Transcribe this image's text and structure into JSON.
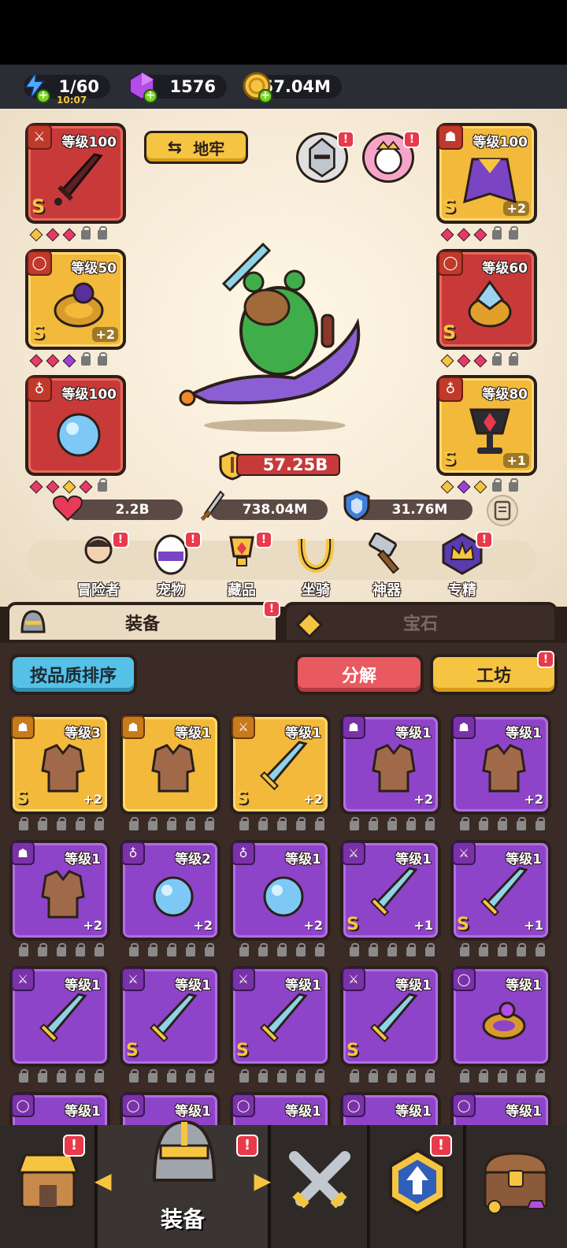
{
  "resources": {
    "energy": "1/60",
    "energy_timer": "10:07",
    "gems": "1576",
    "gold": "57.04M"
  },
  "arena": {
    "dungeon_label": "地牢",
    "combat_power": "57.25B",
    "stats": {
      "hp": "2.2B",
      "attack": "738.04M",
      "defense": "31.76M"
    },
    "left_slots": [
      {
        "level": "等级100",
        "quality": "S",
        "plus": "",
        "type": "sword"
      },
      {
        "level": "等级50",
        "quality": "S",
        "plus": "+2",
        "type": "ring"
      },
      {
        "level": "等级100",
        "quality": "",
        "plus": "",
        "type": "necklace"
      }
    ],
    "right_slots": [
      {
        "level": "等级100",
        "quality": "S",
        "plus": "+2",
        "type": "armor"
      },
      {
        "level": "等级60",
        "quality": "S",
        "plus": "",
        "type": "ring"
      },
      {
        "level": "等级80",
        "quality": "S",
        "plus": "+1",
        "type": "necklace"
      }
    ]
  },
  "nav": [
    {
      "label": "冒险者"
    },
    {
      "label": "宠物"
    },
    {
      "label": "藏品"
    },
    {
      "label": "坐骑"
    },
    {
      "label": "神器"
    },
    {
      "label": "专精"
    }
  ],
  "tabs": {
    "equip": "装备",
    "gem": "宝石"
  },
  "actions": {
    "sort": "按品质排序",
    "decompose": "分解",
    "workshop": "工坊"
  },
  "inventory": [
    {
      "level": "等级3",
      "quality": "S",
      "plus": "+2",
      "rarity": "gold",
      "type": "armor"
    },
    {
      "level": "等级1",
      "quality": "",
      "plus": "",
      "rarity": "gold",
      "type": "armor"
    },
    {
      "level": "等级1",
      "quality": "S",
      "plus": "+2",
      "rarity": "gold",
      "type": "sword"
    },
    {
      "level": "等级1",
      "quality": "",
      "plus": "+2",
      "rarity": "purple",
      "type": "armor"
    },
    {
      "level": "等级1",
      "quality": "",
      "plus": "+2",
      "rarity": "purple",
      "type": "armor"
    },
    {
      "level": "等级1",
      "quality": "",
      "plus": "+2",
      "rarity": "purple",
      "type": "armor"
    },
    {
      "level": "等级2",
      "quality": "",
      "plus": "+2",
      "rarity": "purple",
      "type": "necklace"
    },
    {
      "level": "等级1",
      "quality": "",
      "plus": "+2",
      "rarity": "purple",
      "type": "necklace"
    },
    {
      "level": "等级1",
      "quality": "S",
      "plus": "+1",
      "rarity": "purple",
      "type": "sword"
    },
    {
      "level": "等级1",
      "quality": "S",
      "plus": "+1",
      "rarity": "purple",
      "type": "sword"
    },
    {
      "level": "等级1",
      "quality": "",
      "plus": "",
      "rarity": "purple",
      "type": "sword"
    },
    {
      "level": "等级1",
      "quality": "S",
      "plus": "",
      "rarity": "purple",
      "type": "sword"
    },
    {
      "level": "等级1",
      "quality": "S",
      "plus": "",
      "rarity": "purple",
      "type": "sword"
    },
    {
      "level": "等级1",
      "quality": "S",
      "plus": "",
      "rarity": "purple",
      "type": "sword"
    },
    {
      "level": "等级1",
      "quality": "",
      "plus": "",
      "rarity": "purple",
      "type": "ring"
    },
    {
      "level": "等级1",
      "quality": "",
      "plus": "",
      "rarity": "purple",
      "type": "ring"
    },
    {
      "level": "等级1",
      "quality": "",
      "plus": "",
      "rarity": "purple",
      "type": "ring"
    },
    {
      "level": "等级1",
      "quality": "",
      "plus": "",
      "rarity": "purple",
      "type": "ring"
    },
    {
      "level": "等级1",
      "quality": "",
      "plus": "",
      "rarity": "purple",
      "type": "ring"
    },
    {
      "level": "等级1",
      "quality": "",
      "plus": "",
      "rarity": "purple",
      "type": "ring"
    }
  ],
  "bottom_nav": {
    "active_label": "装备"
  },
  "colors": {
    "accent_gold": "#f5c542",
    "alert_red": "#e83a4a",
    "sort_blue": "#55c1e6",
    "decompose_red": "#e85a5f"
  }
}
